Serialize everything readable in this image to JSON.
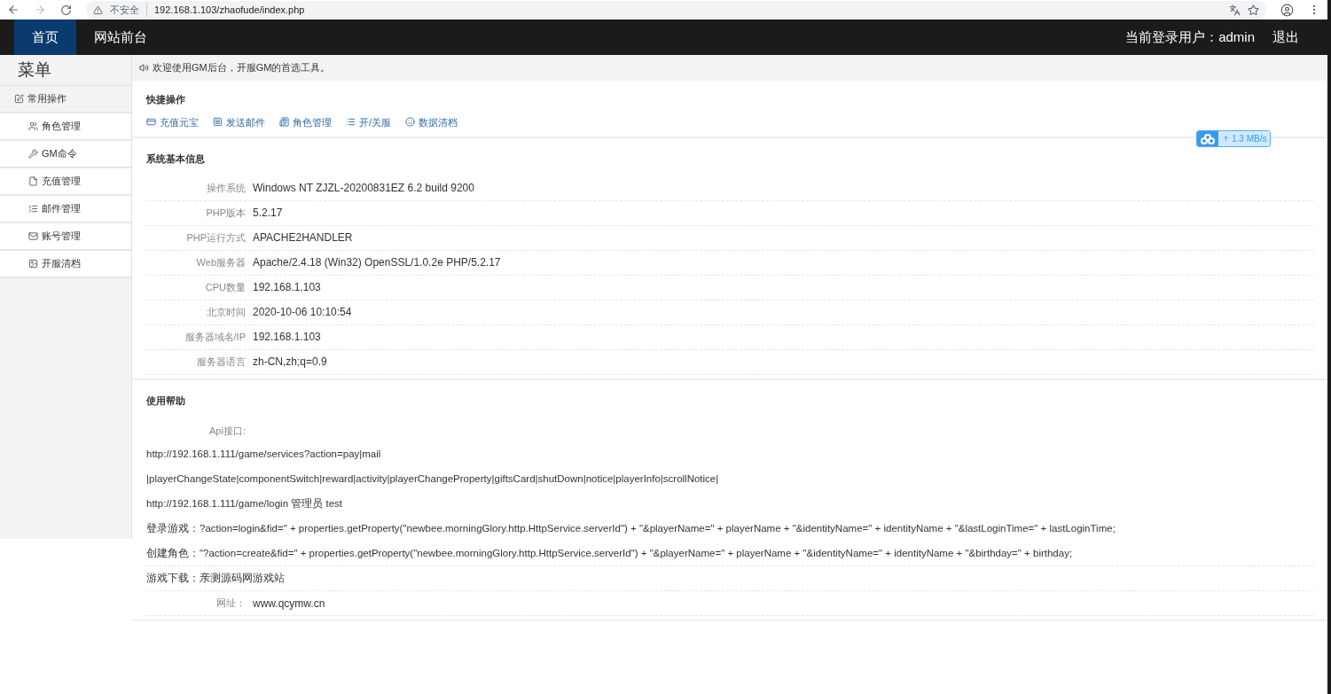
{
  "browser": {
    "security": "不安全",
    "url": "192.168.1.103/zhaofude/index.php"
  },
  "nav": {
    "items": [
      {
        "label": "首页",
        "selected": true
      },
      {
        "label": "网站前台",
        "selected": false
      }
    ],
    "user": "当前登录用户：admin",
    "logout": "退出"
  },
  "sidebar": {
    "title": "菜单",
    "group": "常用操作",
    "items": [
      "角色管理",
      "GM命令",
      "充值管理",
      "邮件管理",
      "账号管理",
      "开服清档"
    ]
  },
  "notice": "欢迎使用GM后台，开服GM的首选工具。",
  "quick": {
    "title": "快捷操作",
    "links": [
      "充值元宝",
      "发送邮件",
      "角色管理",
      "开/关服",
      "数据清档"
    ]
  },
  "sysinfo": {
    "title": "系统基本信息",
    "rows": [
      {
        "label": "操作系统",
        "value": "Windows NT ZJZL-20200831EZ 6.2 build 9200"
      },
      {
        "label": "PHP版本",
        "value": "5.2.17"
      },
      {
        "label": "PHP运行方式",
        "value": "APACHE2HANDLER"
      },
      {
        "label": "Web服务器",
        "value": "Apache/2.4.18 (Win32) OpenSSL/1.0.2e PHP/5.2.17"
      },
      {
        "label": "CPU数量",
        "value": "192.168.1.103"
      },
      {
        "label": "北京时间",
        "value": "2020-10-06 10:10:54"
      },
      {
        "label": "服务器域名/IP",
        "value": "192.168.1.103"
      },
      {
        "label": "服务器语言",
        "value": "zh-CN,zh;q=0.9"
      }
    ]
  },
  "help": {
    "title": "使用帮助",
    "api_label": "Api接口:",
    "lines": [
      "http://192.168.1.111/game/services?action=pay|mail",
      "|playerChangeState|componentSwitch|reward|activity|playerChangeProperty|giftsCard|shutDown|notice|playerInfo|scrollNotice|",
      "http://192.168.1.111/game/login 管理员 test",
      "登录游戏：?action=login&fid=\" + properties.getProperty(\"newbee.morningGlory.http.HttpService.serverId\") + \"&playerName=\" + playerName + \"&identityName=\" + identityName + \"&lastLoginTime=\" + lastLoginTime;",
      "创建角色：\"?action=create&fid=\" + properties.getProperty(\"newbee.morningGlory.http.HttpService.serverId\") + \"&playerName=\" + playerName + \"&identityName=\" + identityName + \"&birthday=\" + birthday;",
      "游戏下载：亲测源码网游戏站"
    ],
    "site_label": "网址：",
    "site": "www.qcymw.cn"
  },
  "speed": {
    "value": "1.3 MB/s"
  }
}
